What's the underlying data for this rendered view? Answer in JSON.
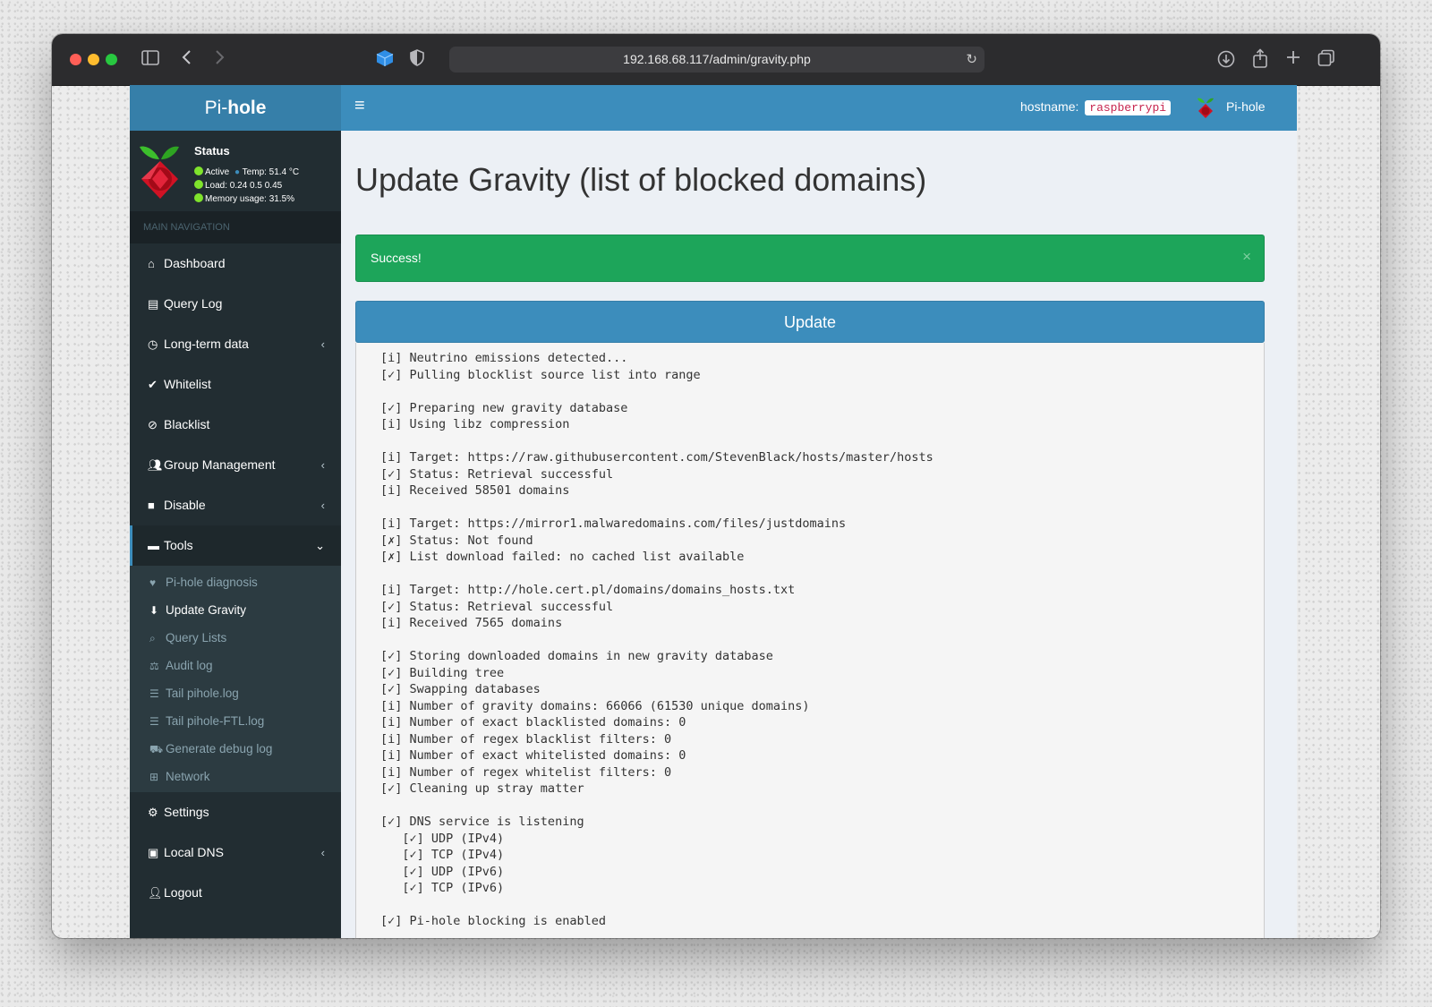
{
  "browser": {
    "url": "192.168.68.117/admin/gravity.php"
  },
  "sidebar": {
    "brand_prefix": "Pi-",
    "brand_bold": "hole",
    "status": {
      "title": "Status",
      "active": "Active",
      "temp": "Temp: 51.4 °C",
      "load": "Load:  0.24  0.5  0.45",
      "memory": "Memory usage:  31.5%"
    },
    "nav_header": "MAIN NAVIGATION",
    "items": [
      {
        "label": "Dashboard",
        "icon": "home-icon"
      },
      {
        "label": "Query Log",
        "icon": "file-icon"
      },
      {
        "label": "Long-term data",
        "icon": "clock-icon",
        "expandable": true
      },
      {
        "label": "Whitelist",
        "icon": "check-circle-icon"
      },
      {
        "label": "Blacklist",
        "icon": "ban-icon"
      },
      {
        "label": "Group Management",
        "icon": "users-icon",
        "expandable": true
      },
      {
        "label": "Disable",
        "icon": "stop-icon",
        "expandable": true
      },
      {
        "label": "Tools",
        "icon": "folder-icon",
        "expanded": true
      }
    ],
    "tools_items": [
      {
        "label": "Pi-hole diagnosis",
        "icon": "stethoscope-icon"
      },
      {
        "label": "Update Gravity",
        "icon": "arrow-circle-down-icon",
        "current": true
      },
      {
        "label": "Query Lists",
        "icon": "search-icon"
      },
      {
        "label": "Audit log",
        "icon": "balance-scale-icon"
      },
      {
        "label": "Tail pihole.log",
        "icon": "list-icon"
      },
      {
        "label": "Tail pihole-FTL.log",
        "icon": "list-icon"
      },
      {
        "label": "Generate debug log",
        "icon": "ambulance-icon"
      },
      {
        "label": "Network",
        "icon": "network-icon"
      }
    ],
    "bottom_items": [
      {
        "label": "Settings",
        "icon": "cogs-icon"
      },
      {
        "label": "Local DNS",
        "icon": "address-book-icon",
        "expandable": true
      },
      {
        "label": "Logout",
        "icon": "user-times-icon"
      }
    ]
  },
  "topbar": {
    "hostname_label": "hostname:",
    "hostname_value": "raspberrypi",
    "user": "Pi-hole"
  },
  "main": {
    "title": "Update Gravity (list of blocked domains)",
    "alert": "Success!",
    "update_button": "Update",
    "output_lines": [
      "[i] Neutrino emissions detected...",
      "[✓] Pulling blocklist source list into range",
      "",
      "[✓] Preparing new gravity database",
      "[i] Using libz compression",
      "",
      "[i] Target: https://raw.githubusercontent.com/StevenBlack/hosts/master/hosts",
      "[✓] Status: Retrieval successful",
      "[i] Received 58501 domains",
      "",
      "[i] Target: https://mirror1.malwaredomains.com/files/justdomains",
      "[✗] Status: Not found",
      "[✗] List download failed: no cached list available",
      "",
      "[i] Target: http://hole.cert.pl/domains/domains_hosts.txt",
      "[✓] Status: Retrieval successful",
      "[i] Received 7565 domains",
      "",
      "[✓] Storing downloaded domains in new gravity database",
      "[✓] Building tree",
      "[✓] Swapping databases",
      "[i] Number of gravity domains: 66066 (61530 unique domains)",
      "[i] Number of exact blacklisted domains: 0",
      "[i] Number of regex blacklist filters: 0",
      "[i] Number of exact whitelisted domains: 0",
      "[i] Number of regex whitelist filters: 0",
      "[✓] Cleaning up stray matter",
      "",
      "[✓] DNS service is listening",
      "   [✓] UDP (IPv4)",
      "   [✓] TCP (IPv4)",
      "   [✓] UDP (IPv6)",
      "   [✓] TCP (IPv6)",
      "",
      "[✓] Pi-hole blocking is enabled"
    ]
  },
  "colors": {
    "brand_blue": "#3c8dbc",
    "sidebar_dark": "#222d32",
    "success_green": "#1da55a"
  }
}
